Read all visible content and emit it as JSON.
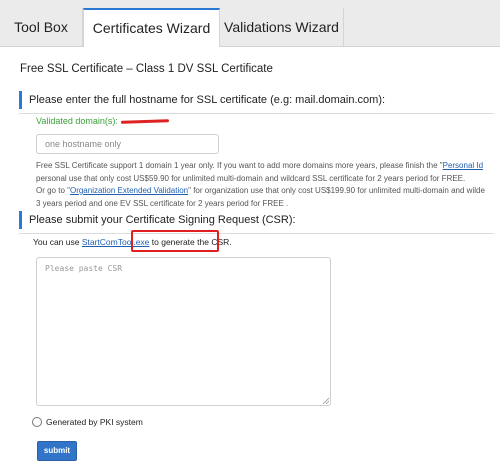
{
  "tabs": [
    {
      "label": "Tool Box"
    },
    {
      "label": "Certificates Wizard",
      "active": true
    },
    {
      "label": "Validations Wizard"
    }
  ],
  "page_title": "Free SSL Certificate – Class 1 DV SSL Certificate",
  "hostname_section": {
    "heading": "Please enter the full hostname for SSL certificate (e.g: mail.domain.com):",
    "validated_label": "Validated domain(s):",
    "input_placeholder": "one hostname only",
    "info_line1_a": "Free SSL Certificate support 1 domain 1 year only. If you want to add more domains more years, please finish the \"",
    "info_line1_link": "Personal Id",
    "info_line2": "personal use that only cost US$59.90 for unlimited multi-domain and wildcard SSL certificate for 2 years period for FREE.",
    "info_line3_a": "Or go to \"",
    "info_line3_link": "Organization Extended Validation",
    "info_line3_b": "\" for organization use that only cost US$199.90 for unlimited multi-domain and wilde",
    "info_line4": "3 years period and one EV SSL certificate for 2 years period for FREE ."
  },
  "csr_section": {
    "heading": "Please submit your Certificate Signing Request (CSR):",
    "hint_prefix": "You can use ",
    "hint_link": "StartComTool.exe",
    "hint_suffix": " to generate the CSR.",
    "textarea_placeholder": "Please paste CSR"
  },
  "pki_option": {
    "label": "Generated by PKI system"
  },
  "submit": {
    "label": "submit"
  },
  "colors": {
    "accent": "#2a7ad3",
    "validated": "#3aa33a",
    "annotation": "#e02020",
    "button": "#3174c8"
  }
}
